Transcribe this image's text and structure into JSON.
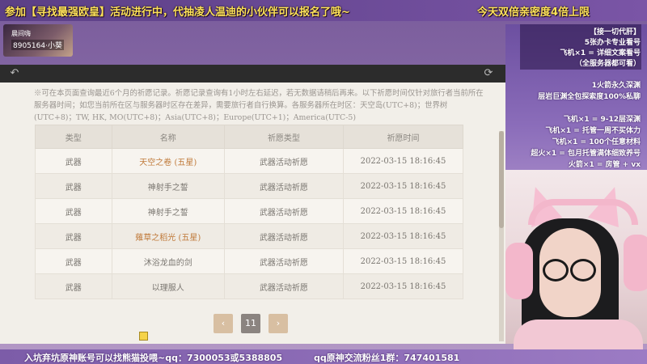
{
  "banner": {
    "left_text": "参加【寻找最强欧皇】活动进行中，代抽凌人温迪的小伙伴可以报名了哦~",
    "right_text": "今天双倍亲密度4倍上限"
  },
  "avatar_card": {
    "line1": "晨间嗨",
    "line2": "8905164·小葵"
  },
  "right_panel": {
    "lines": [
      "【接一切代肝】",
      "5张办卡专业看号",
      "飞机×1 = 详细文案看号",
      "（全服务器都可看）",
      "1火箭永久深渊",
      "层岩巨渊全包探索度100%私聊",
      "飞机×1 = 9-12层深渊",
      "飞机×1 = 托管一周不买体力",
      "飞机×1 = 100个任意材料",
      "超火×1 = 包月托管满体细致养号",
      "火箭×1 = 房管 + vx"
    ]
  },
  "game": {
    "toolbar": {
      "back_icon": "back-arrow-icon",
      "refresh_icon": "refresh-icon"
    },
    "notice": "※可在本页面查询最近6个月的祈愿记录。祈愿记录查询有1小时左右延迟，若无数据请稍后再来。以下祈愿时间仅针对旅行者当前所在服务器时间；如您当前所在区与服务器时区存在差异，需要旅行者自行换算。各服务器所在时区：天空岛(UTC+8)；世界树(UTC+8)；TW, HK, MO(UTC+8)；Asia(UTC+8)；Europe(UTC+1)；America(UTC-5)",
    "table": {
      "headers": [
        "类型",
        "名称",
        "祈愿类型",
        "祈愿时间"
      ],
      "rows": [
        {
          "type": "武器",
          "name": "天空之卷 (五星)",
          "prayer": "武器活动祈愿",
          "time": "2022-03-15 18:16:45"
        },
        {
          "type": "武器",
          "name": "神射手之誓",
          "prayer": "武器活动祈愿",
          "time": "2022-03-15 18:16:45"
        },
        {
          "type": "武器",
          "name": "神射手之誓",
          "prayer": "武器活动祈愿",
          "time": "2022-03-15 18:16:45"
        },
        {
          "type": "武器",
          "name": "薙草之稻光 (五星)",
          "prayer": "武器活动祈愿",
          "time": "2022-03-15 18:16:45"
        },
        {
          "type": "武器",
          "name": "沐浴龙血的剑",
          "prayer": "武器活动祈愿",
          "time": "2022-03-15 18:16:45"
        },
        {
          "type": "武器",
          "name": "以理服人",
          "prayer": "武器活动祈愿",
          "time": "2022-03-15 18:16:45"
        }
      ]
    },
    "pager": {
      "prev": "‹",
      "current": "11",
      "next": "›"
    }
  },
  "bottom_bar": {
    "left_text": "入坑弃坑原神账号可以找熊猫投喂~qq：7300053或5388805",
    "right_text": "qq原神交流粉丝1群：747401581"
  },
  "colors": {
    "five_star": "#c07a3a",
    "banner_text": "#ffe25a"
  }
}
